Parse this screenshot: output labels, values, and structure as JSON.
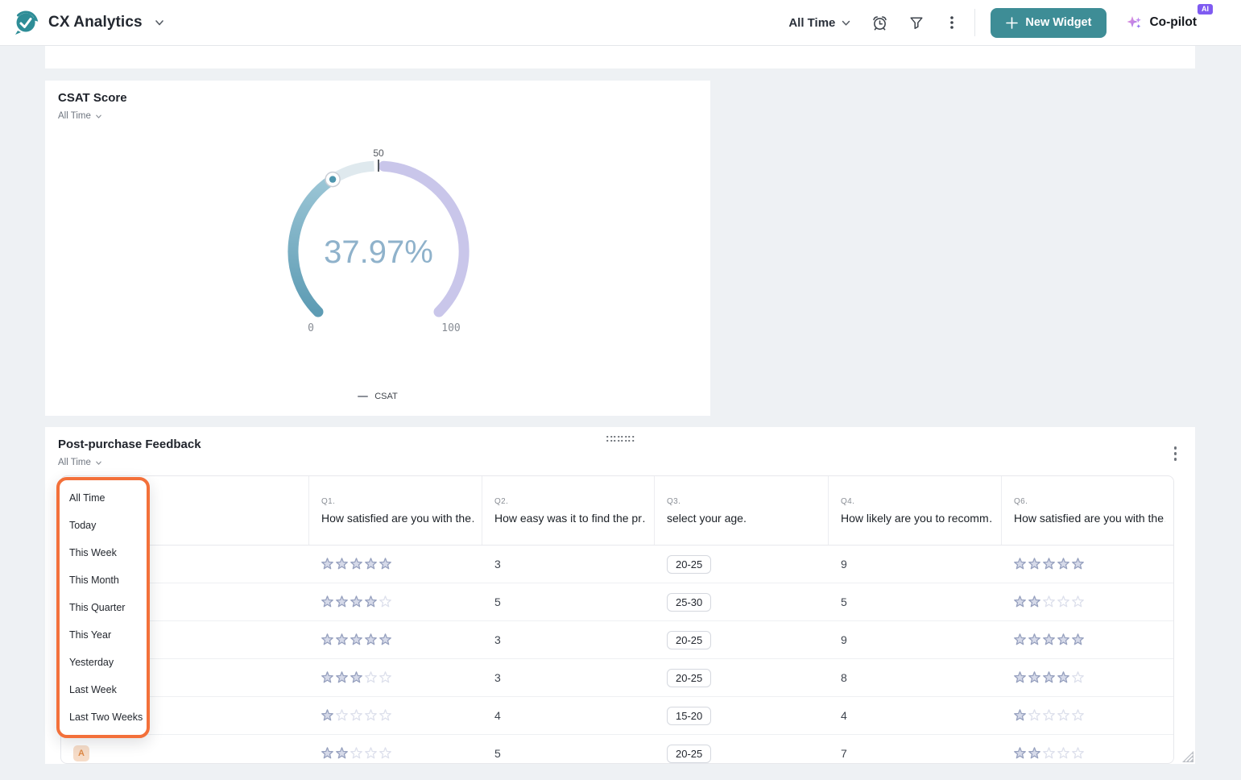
{
  "header": {
    "app_title": "CX Analytics",
    "time_filter": "All Time",
    "new_widget_label": "New Widget",
    "copilot_label": "Co-pilot",
    "ai_badge": "AI"
  },
  "icons": {
    "logo": "check-bubble",
    "title_chevron": "chevron-down",
    "time_filter_chevron": "chevron-down",
    "alarm": "alarm-clock",
    "filter": "funnel",
    "more": "kebab-vertical",
    "new_widget_plus": "plus",
    "copilot_spark": "sparkles",
    "widget_drag": "drag-dots",
    "widget_more": "kebab-vertical",
    "resize": "resize-handle",
    "rating": "star"
  },
  "colors": {
    "accent_teal": "#3E8D96",
    "highlight_orange": "#F3703A",
    "ai_badge_purple": "#7F5BF1",
    "gauge_track_light": "#DFE9EE",
    "gauge_track_lavender": "#C9C6EA",
    "gauge_progress_start": "#5E9CB4",
    "gauge_progress_end": "#9CC6D6",
    "gauge_value_text": "#8FB2CB",
    "gauge_marker": "#4E96AE",
    "star_fill": "#D6DAE9",
    "star_stroke": "#97A1BF",
    "star_empty_stroke": "#DDE0EC"
  },
  "csat_widget": {
    "title": "CSAT Score",
    "time_filter": "All Time",
    "legend_label": "CSAT"
  },
  "chart_data": {
    "type": "gauge",
    "title": "CSAT Score",
    "value": 37.97,
    "value_label": "37.97%",
    "min": 0,
    "max": 100,
    "min_label": "0",
    "max_label": "100",
    "top_tick_label": "50",
    "start_angle": 225,
    "end_angle": -45,
    "segments": [
      {
        "range": [
          0,
          50
        ],
        "color": "#DFE9EE"
      },
      {
        "range": [
          50,
          100
        ],
        "color": "#C9C6EA"
      }
    ],
    "legend": [
      "CSAT"
    ]
  },
  "feedback_widget": {
    "title": "Post-purchase Feedback",
    "time_filter": "All Time",
    "dropdown": {
      "options": [
        "All Time",
        "Today",
        "This Week",
        "This Month",
        "This Quarter",
        "This Year",
        "Yesterday",
        "Last Week",
        "Last Two Weeks"
      ]
    },
    "table": {
      "stars_max": 5,
      "columns": [
        {
          "qnum": "Q1.",
          "label": "How satisfied are you with the…",
          "type": "stars"
        },
        {
          "qnum": "Q2.",
          "label": "How easy was it to find the pr…",
          "type": "number"
        },
        {
          "qnum": "Q3.",
          "label": "select your age.",
          "type": "chip"
        },
        {
          "qnum": "Q4.",
          "label": "How likely are you to recomm…",
          "type": "number"
        },
        {
          "qnum": "Q6.",
          "label": "How satisfied are you with the…",
          "type": "stars"
        }
      ],
      "rows": [
        {
          "user": "",
          "q1_stars": 5,
          "q2": "3",
          "q3": "20-25",
          "q4": "9",
          "q6_stars": 5
        },
        {
          "user": "",
          "q1_stars": 4,
          "q2": "5",
          "q3": "25-30",
          "q4": "5",
          "q6_stars": 2
        },
        {
          "user": "",
          "q1_stars": 5,
          "q2": "3",
          "q3": "20-25",
          "q4": "9",
          "q6_stars": 5
        },
        {
          "user": "",
          "q1_stars": 3,
          "q2": "3",
          "q3": "20-25",
          "q4": "8",
          "q6_stars": 4
        },
        {
          "user": "",
          "q1_stars": 1,
          "q2": "4",
          "q3": "15-20",
          "q4": "4",
          "q6_stars": 1
        },
        {
          "user": "A",
          "q1_stars": 2,
          "q2": "5",
          "q3": "20-25",
          "q4": "7",
          "q6_stars": 2
        }
      ]
    }
  }
}
